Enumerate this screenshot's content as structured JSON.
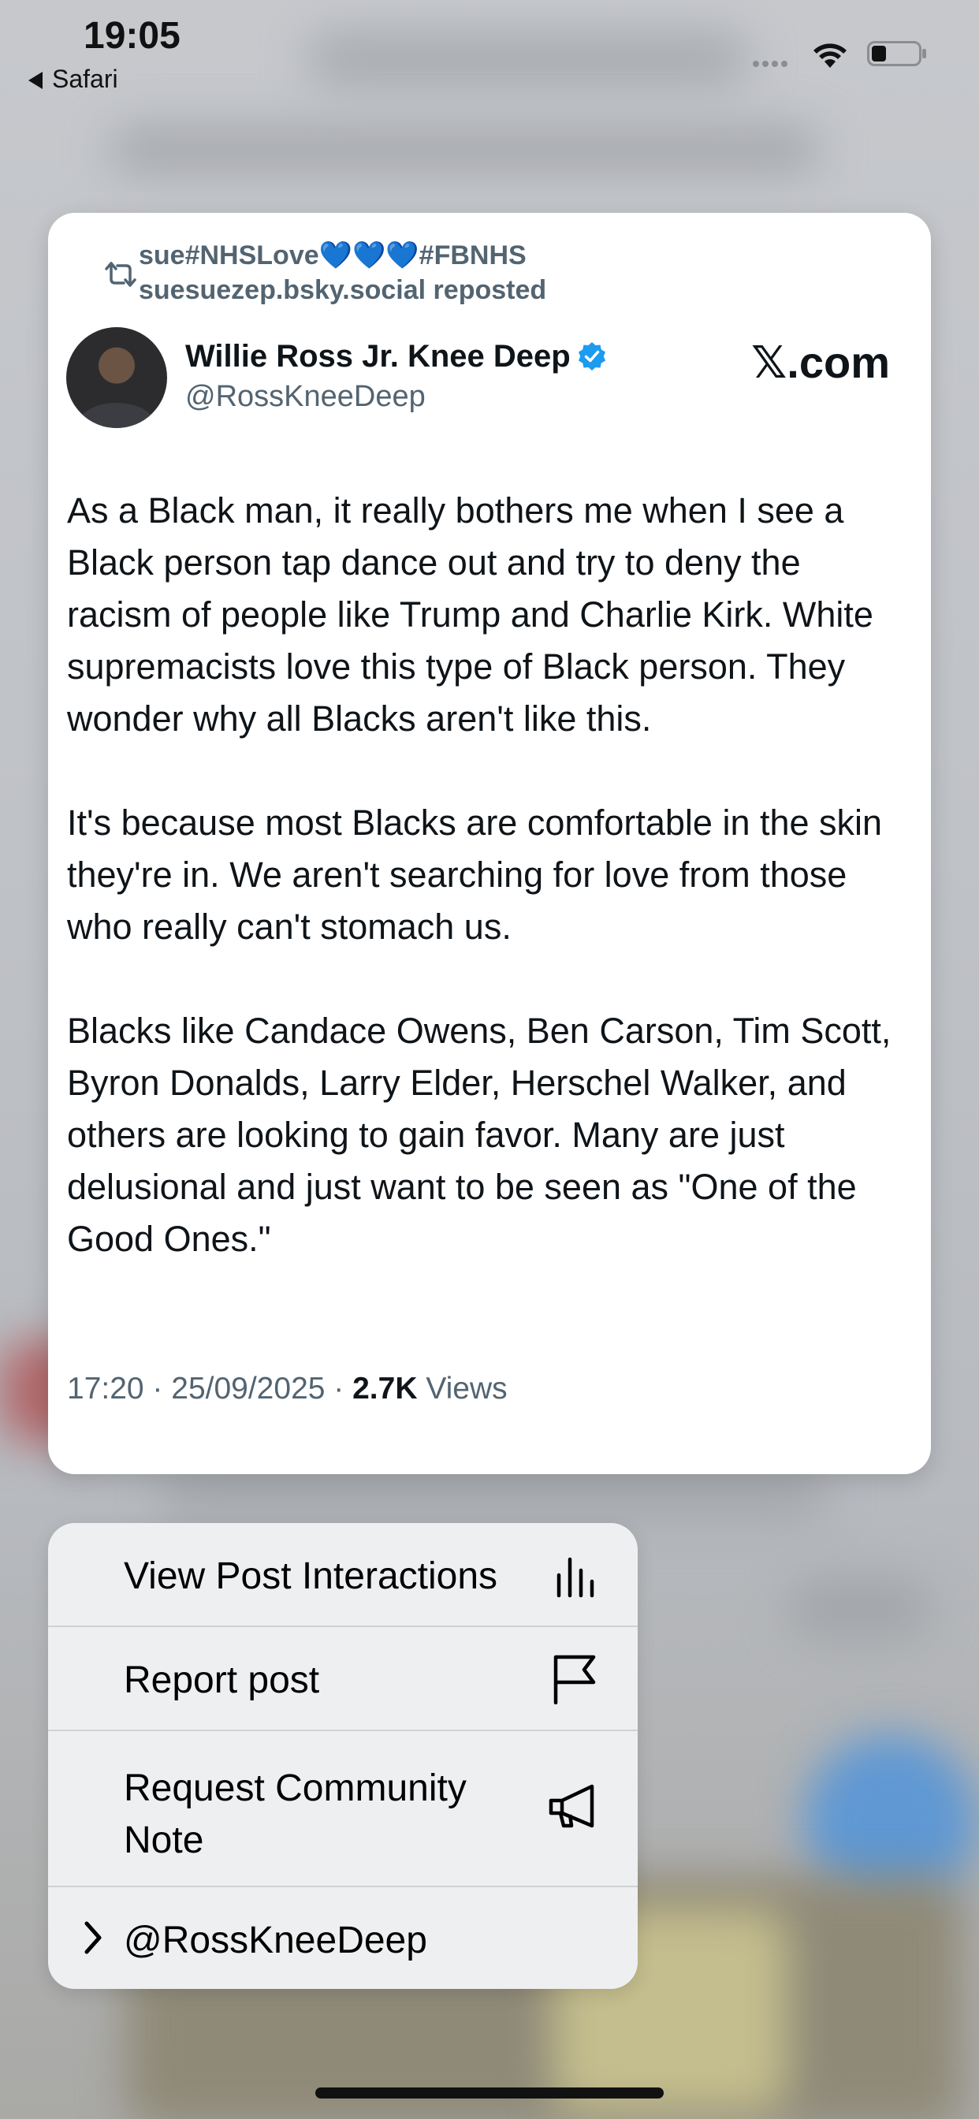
{
  "status_bar": {
    "time": "19:05",
    "back_label": "Safari"
  },
  "post": {
    "repost_user_line": "sue#NHSLove",
    "repost_hearts": "💙💙💙",
    "repost_tag": "#FBNHS",
    "repost_account_line": "suesuezep.bsky.social reposted",
    "author_name": "Willie Ross Jr. Knee Deep",
    "author_handle": "@RossKneeDeep",
    "source": "𝕏.com",
    "paragraph_1": "As a Black man, it really bothers me when I see a Black person tap dance out and try to deny the racism of people like Trump and Charlie Kirk. White supremacists love this type of Black person. They wonder why all Blacks aren't like this.",
    "paragraph_2": "It's because most Blacks are comfortable in the skin they're in. We aren't searching for love from those who really can't stomach us.",
    "paragraph_3": "Blacks like Candace Owens, Ben Carson, Tim Scott, Byron Donalds, Larry Elder, Herschel Walker, and others are looking to gain favor. Many are just delusional and just want to be seen as \"One of the Good Ones.\"",
    "timestamp": "17:20 · 25/09/2025 · ",
    "views_count": "2.7K",
    "views_label": " Views"
  },
  "menu": {
    "items": [
      {
        "label": "View Post Interactions",
        "icon": "bar-chart-icon"
      },
      {
        "label": "Report post",
        "icon": "flag-icon"
      },
      {
        "label_line1": "Request Community",
        "label_line2": "Note",
        "icon": "megaphone-icon"
      },
      {
        "label": "@RossKneeDeep",
        "icon": "chevron-right-icon"
      }
    ]
  },
  "colors": {
    "link_blue": "#1d9bf0",
    "secondary_text": "#536471",
    "primary_text": "#0f1419"
  }
}
